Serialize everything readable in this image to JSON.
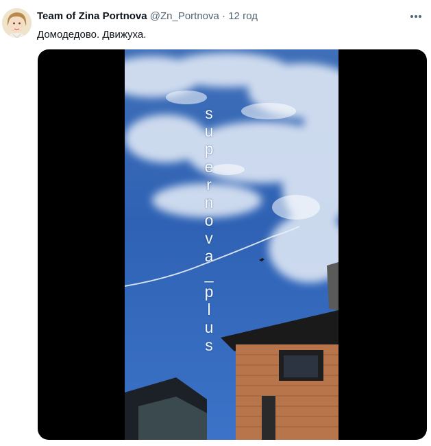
{
  "tweet": {
    "display_name": "Team of Zina Portnova",
    "handle": "@Zn_Portnova",
    "separator": "·",
    "time": "12 год",
    "text": "Домодедово. Движуха.",
    "watermark": "supernova_plus"
  },
  "icons": {
    "more": "more-options-icon",
    "avatar": "user-avatar"
  },
  "colors": {
    "text_primary": "#0f1419",
    "text_secondary": "#536471",
    "media_background": "#000000",
    "sky": "#3a6fc0"
  }
}
